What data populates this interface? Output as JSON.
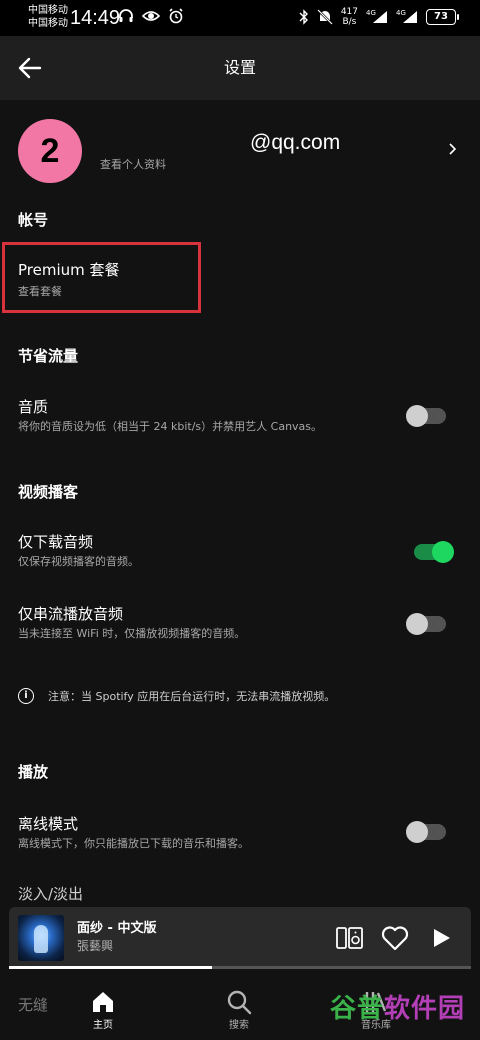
{
  "status_bar": {
    "carrier_1": "中国移动",
    "carrier_2": "中国移动",
    "time": "14:49",
    "speed_value": "417",
    "speed_unit": "B/s",
    "network_1": "4G",
    "network_2": "4G",
    "battery": "73",
    "icons_left": [
      "headphones-icon",
      "eye-icon",
      "alarm-icon"
    ],
    "icons_right": [
      "bluetooth-icon",
      "mute-icon",
      "signal-icon",
      "wifi-icon",
      "battery-icon"
    ]
  },
  "header": {
    "title": "设置",
    "back_icon": "back-arrow-icon"
  },
  "profile": {
    "avatar_text": "2",
    "avatar_color": "#f277a4",
    "email": "@qq.com",
    "subtitle": "查看个人资料"
  },
  "account": {
    "section_title": "帐号",
    "plan_title": "Premium 套餐",
    "plan_sub": "查看套餐"
  },
  "data_saver": {
    "section_title": "节省流量",
    "audio_quality": {
      "title": "音质",
      "subtitle": "将你的音质设为低（相当于 24 kbit/s）并禁用艺人 Canvas。",
      "on": false
    }
  },
  "video_podcasts": {
    "section_title": "视频播客",
    "download_audio_only": {
      "title": "仅下载音频",
      "subtitle": "仅保存视频播客的音频。",
      "on": true
    },
    "stream_audio_only": {
      "title": "仅串流播放音频",
      "subtitle": "当未连接至 WiFi 时，仅播放视频播客的音频。",
      "on": false
    },
    "note": "注意：当 Spotify 应用在后台运行时，无法串流播放视频。"
  },
  "playback": {
    "section_title": "播放",
    "offline_mode": {
      "title": "离线模式",
      "subtitle": "离线模式下，你只能播放已下载的音乐和播客。",
      "on": false
    },
    "crossfade": {
      "title": "淡入/淡出"
    },
    "gapless_label": "无缝"
  },
  "mini_player": {
    "track_title": "面纱 - 中文版",
    "artist": "張藝興",
    "progress_percent": 44
  },
  "bottom_nav": {
    "items": [
      {
        "label": "主页",
        "icon": "home-icon",
        "active": true
      },
      {
        "label": "搜索",
        "icon": "search-icon",
        "active": false
      },
      {
        "label": "音乐库",
        "icon": "library-icon",
        "active": false
      }
    ]
  },
  "watermark": {
    "part_1": "谷普",
    "part_2": "软件园"
  },
  "colors": {
    "background": "#121212",
    "header": "#1f1f1f",
    "accent_green": "#1ed760",
    "highlight_red": "#d8323c"
  }
}
